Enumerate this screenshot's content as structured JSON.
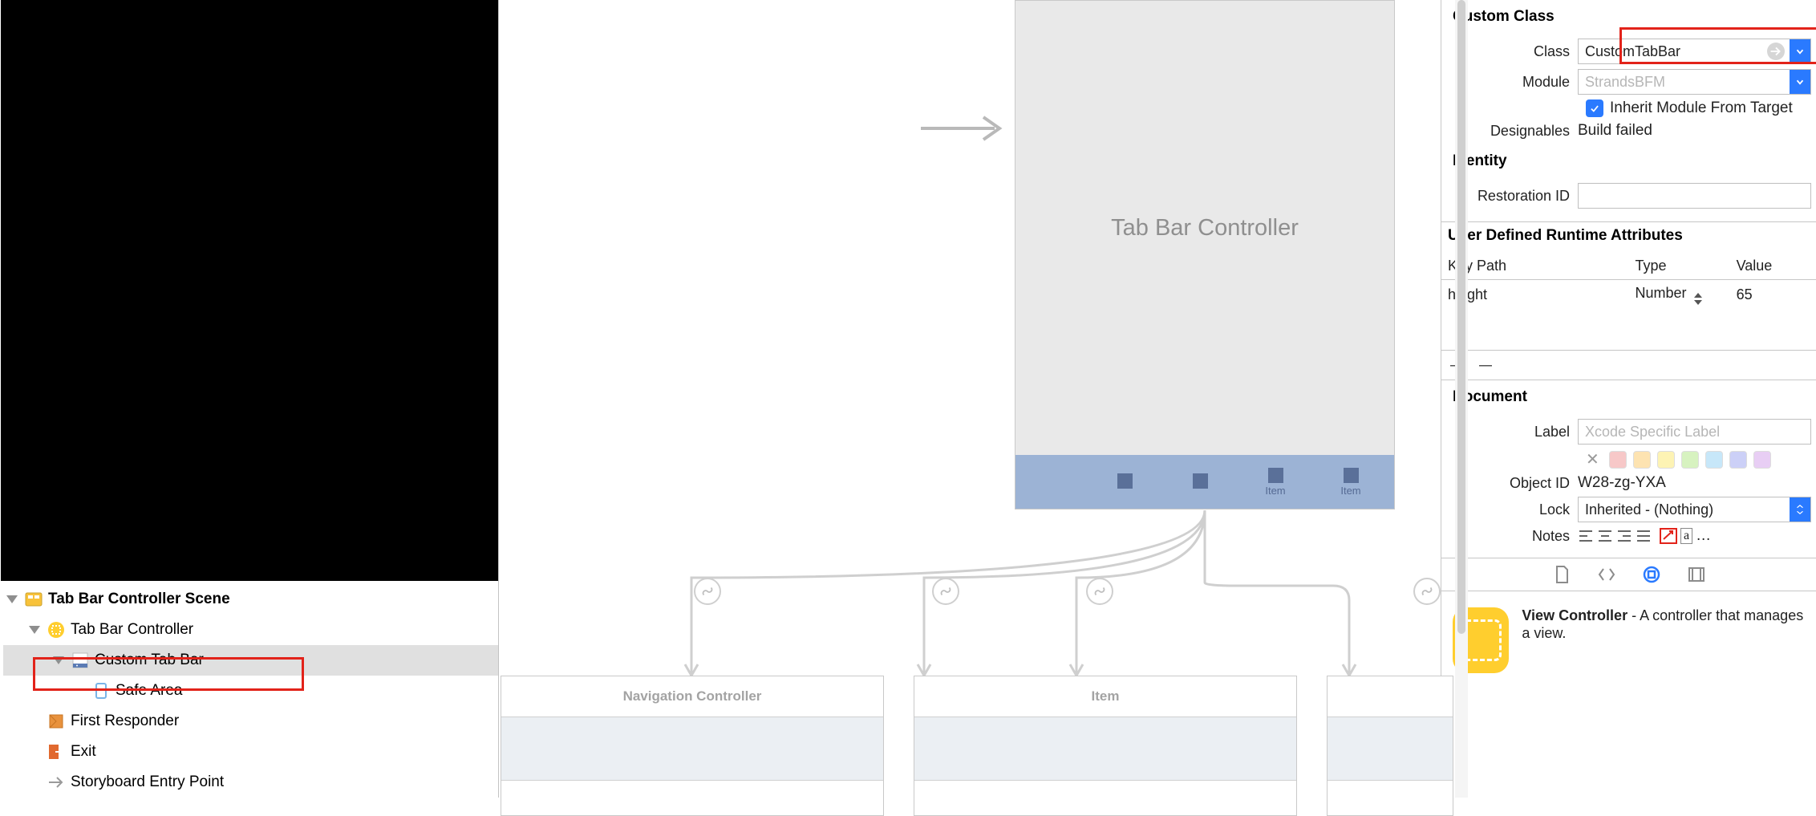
{
  "outline": {
    "scene": "Tab Bar Controller Scene",
    "items": [
      "Tab Bar Controller",
      "Custom Tab Bar",
      "Safe Area",
      "First Responder",
      "Exit",
      "Storyboard Entry Point"
    ]
  },
  "canvas": {
    "controller_title": "Tab Bar Controller",
    "tab_items": [
      "",
      "",
      "Item",
      "Item"
    ],
    "dest_boxes": [
      "Navigation Controller",
      "Item"
    ]
  },
  "inspector": {
    "custom_class": {
      "title": "Custom Class",
      "class_label": "Class",
      "class_value": "CustomTabBar",
      "module_label": "Module",
      "module_placeholder": "StrandsBFM",
      "inherit_label": "Inherit Module From Target",
      "designables_label": "Designables",
      "designables_value": "Build failed"
    },
    "identity": {
      "title": "Identity",
      "restoration_label": "Restoration ID",
      "restoration_value": ""
    },
    "runtime": {
      "title": "User Defined Runtime Attributes",
      "headers": [
        "Key Path",
        "Type",
        "Value"
      ],
      "rows": [
        {
          "key": "height",
          "type": "Number",
          "value": "65"
        }
      ]
    },
    "document": {
      "title": "Document",
      "label_label": "Label",
      "label_placeholder": "Xcode Specific Label",
      "colors": [
        "#f7c8c8",
        "#fde3b1",
        "#fdf3b4",
        "#d7f2c0",
        "#c7e7f9",
        "#ccd0f7",
        "#e8cef4"
      ],
      "object_id_label": "Object ID",
      "object_id_value": "W28-zg-YXA",
      "lock_label": "Lock",
      "lock_value": "Inherited - (Nothing)",
      "notes_label": "Notes"
    },
    "library": {
      "title": "View Controller",
      "desc": " - A controller that manages a view."
    }
  }
}
